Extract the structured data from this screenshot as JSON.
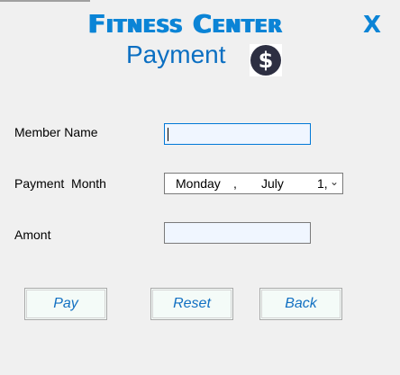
{
  "header": {
    "title": "Fitness Center",
    "close_label": "X",
    "subtitle": "Payment",
    "dollar_symbol": "$"
  },
  "form": {
    "member_name": {
      "label": "Member Name",
      "value": ""
    },
    "payment_month": {
      "label": "Payment  Month",
      "weekday": "Monday",
      "sep": ",",
      "month": "July",
      "day": "1,",
      "dropdown_icon": "chevron-down-icon"
    },
    "amount": {
      "label": "Amont",
      "value": ""
    }
  },
  "buttons": {
    "pay": "Pay",
    "reset": "Reset",
    "back": "Back"
  },
  "colors": {
    "accent": "#0b84d6",
    "background": "#f0f0f0",
    "button_text": "#1270c2"
  }
}
